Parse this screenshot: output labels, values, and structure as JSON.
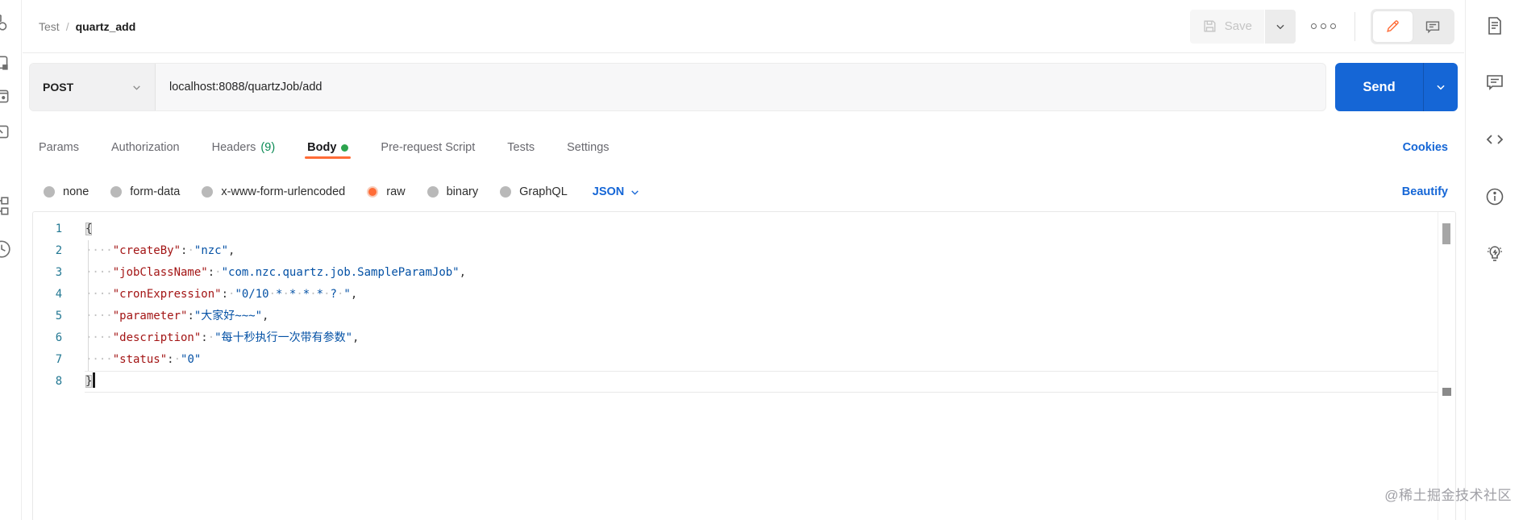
{
  "header": {
    "breadcrumb": {
      "collection": "Test",
      "separator": "/",
      "request": "quartz_add"
    },
    "save_label": "Save"
  },
  "request_bar": {
    "method": "POST",
    "url": "localhost:8088/quartzJob/add",
    "send_label": "Send"
  },
  "tabs": {
    "items": [
      {
        "label": "Params"
      },
      {
        "label": "Authorization"
      },
      {
        "label": "Headers",
        "count": "(9)"
      },
      {
        "label": "Body",
        "active": true,
        "unsaved_dot": true
      },
      {
        "label": "Pre-request Script"
      },
      {
        "label": "Tests"
      },
      {
        "label": "Settings"
      }
    ],
    "cookies_link": "Cookies"
  },
  "body_type_bar": {
    "options": [
      "none",
      "form-data",
      "x-www-form-urlencoded",
      "raw",
      "binary",
      "GraphQL"
    ],
    "selected": "raw",
    "format_select": "JSON",
    "beautify_link": "Beautify"
  },
  "editor": {
    "language": "JSON",
    "lines": [
      {
        "num": 1,
        "segments": [
          [
            "b",
            "{"
          ]
        ]
      },
      {
        "num": 2,
        "segments": [
          [
            "w",
            "····"
          ],
          [
            "k",
            "\"createBy\""
          ],
          [
            "p",
            ":"
          ],
          [
            "w",
            "·"
          ],
          [
            "v",
            "\"nzc\""
          ],
          [
            "p",
            ","
          ]
        ]
      },
      {
        "num": 3,
        "segments": [
          [
            "w",
            "····"
          ],
          [
            "k",
            "\"jobClassName\""
          ],
          [
            "p",
            ":"
          ],
          [
            "w",
            "·"
          ],
          [
            "v",
            "\"com.nzc.quartz.job.SampleParamJob\""
          ],
          [
            "p",
            ","
          ]
        ]
      },
      {
        "num": 4,
        "segments": [
          [
            "w",
            "····"
          ],
          [
            "k",
            "\"cronExpression\""
          ],
          [
            "p",
            ":"
          ],
          [
            "w",
            "·"
          ],
          [
            "v",
            "\"0/10"
          ],
          [
            "w",
            "·"
          ],
          [
            "v",
            "*"
          ],
          [
            "w",
            "·"
          ],
          [
            "v",
            "*"
          ],
          [
            "w",
            "·"
          ],
          [
            "v",
            "*"
          ],
          [
            "w",
            "·"
          ],
          [
            "v",
            "*"
          ],
          [
            "w",
            "·"
          ],
          [
            "v",
            "?"
          ],
          [
            "w",
            "·"
          ],
          [
            "v",
            "\""
          ],
          [
            "p",
            ","
          ]
        ]
      },
      {
        "num": 5,
        "segments": [
          [
            "w",
            "····"
          ],
          [
            "k",
            "\"parameter\""
          ],
          [
            "p",
            ":"
          ],
          [
            "v",
            "\"大家好~~~\""
          ],
          [
            "p",
            ","
          ]
        ]
      },
      {
        "num": 6,
        "segments": [
          [
            "w",
            "····"
          ],
          [
            "k",
            "\"description\""
          ],
          [
            "p",
            ":"
          ],
          [
            "w",
            "·"
          ],
          [
            "v",
            "\"每十秒执行一次带有参数\""
          ],
          [
            "p",
            ","
          ]
        ]
      },
      {
        "num": 7,
        "segments": [
          [
            "w",
            "····"
          ],
          [
            "k",
            "\"status\""
          ],
          [
            "p",
            ":"
          ],
          [
            "w",
            "·"
          ],
          [
            "v",
            "\"0\""
          ]
        ]
      },
      {
        "num": 8,
        "segments": [
          [
            "b",
            "}"
          ],
          [
            "c",
            ""
          ]
        ],
        "current_line": true
      }
    ]
  },
  "watermark": "@稀土掘金技术社区",
  "colors": {
    "accent_orange": "#ff6c37",
    "link_blue": "#1566d6",
    "send_blue": "#1566d6",
    "key_red": "#a31515",
    "value_blue": "#0451a5",
    "line_number_teal": "#237893",
    "headers_count_green": "#0a8a54",
    "unsaved_dot_green": "#2ca44e"
  }
}
